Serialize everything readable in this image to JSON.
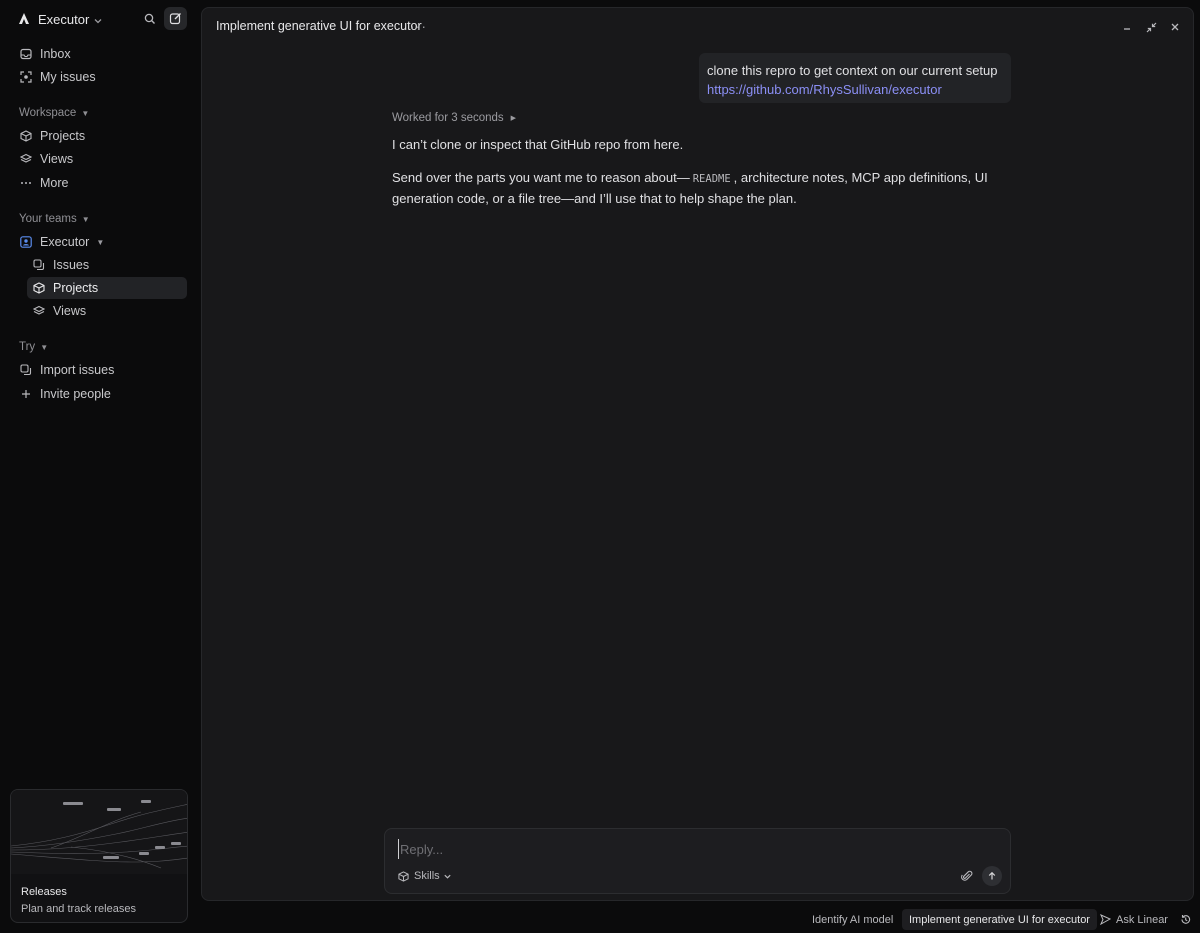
{
  "workspace": {
    "name": "Executor"
  },
  "sidebar": {
    "top_items": [
      {
        "label": "Inbox",
        "icon": "inbox-icon"
      },
      {
        "label": "My issues",
        "icon": "my-issues-icon"
      }
    ],
    "workspace_section": {
      "label": "Workspace",
      "items": [
        {
          "label": "Projects",
          "icon": "cube-icon"
        },
        {
          "label": "Views",
          "icon": "layers-icon"
        },
        {
          "label": "More",
          "icon": "ellipsis-icon"
        }
      ]
    },
    "teams_section": {
      "label": "Your teams",
      "team": {
        "label": "Executor",
        "icon": "team-icon"
      },
      "items": [
        {
          "label": "Issues",
          "icon": "issues-icon"
        },
        {
          "label": "Projects",
          "icon": "cube-icon",
          "active": true
        },
        {
          "label": "Views",
          "icon": "layers-icon"
        }
      ]
    },
    "try_section": {
      "label": "Try",
      "items": [
        {
          "label": "Import issues",
          "icon": "import-icon"
        },
        {
          "label": "Invite people",
          "icon": "plus-icon"
        }
      ]
    },
    "promo": {
      "title": "Releases",
      "subtitle": "Plan and track releases"
    }
  },
  "panel": {
    "title": "Implement generative UI for executor",
    "more_label": "···"
  },
  "conversation": {
    "user_message": {
      "text": "clone this repro to get context on our current setup",
      "link": "https://github.com/RhysSullivan/executor"
    },
    "worked_label": "Worked for 3 seconds",
    "assistant": {
      "p1": "I can’t clone or inspect that GitHub repo from here.",
      "p2_before": "Send over the parts you want me to reason about—",
      "p2_code": "README",
      "p2_after": ", architecture notes, MCP app definitions, UI generation code, or a file tree—and I’ll use that to help shape the plan."
    }
  },
  "composer": {
    "placeholder": "Reply...",
    "skills_label": "Skills"
  },
  "bottom_bar": {
    "identify_label": "Identify AI model",
    "active_tab_label": "Implement generative UI for executor",
    "ask_label": "Ask Linear"
  },
  "colors": {
    "accent_link": "#8b8ff5",
    "team_icon": "#5b8def",
    "panel_bg": "#18181a",
    "sidebar_bg": "#0b0b0c"
  }
}
